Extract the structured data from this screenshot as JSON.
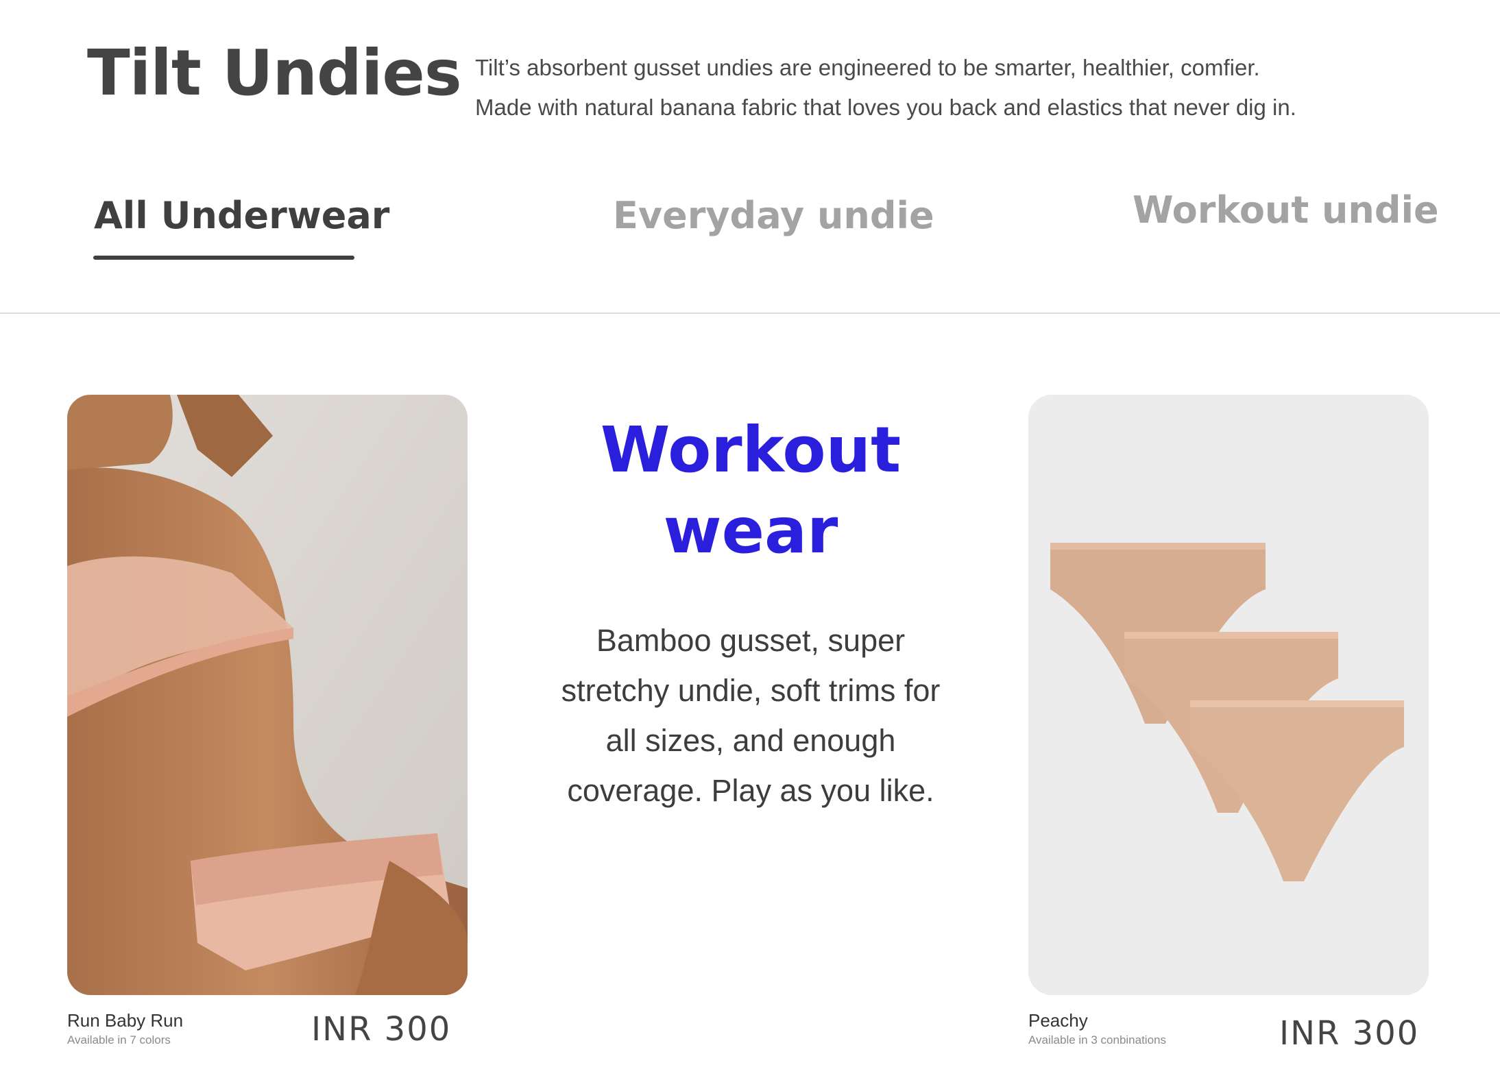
{
  "header": {
    "title": "Tilt Undies",
    "description_lines": [
      "Tilt’s absorbent gusset undies are engineered to be smarter, healthier, comfier.",
      "Made with natural banana fabric that loves you back and elastics that never dig in."
    ]
  },
  "tabs": [
    {
      "label": "All Underwear",
      "active": true
    },
    {
      "label": "Everyday undie",
      "active": false
    },
    {
      "label": "Workout undie",
      "active": false
    }
  ],
  "feature": {
    "title_lines": [
      "Workout",
      "wear"
    ],
    "description_lines": [
      "Bamboo gusset, super",
      "stretchy undie, soft trims for",
      "all sizes, and enough",
      "coverage. Play as you like."
    ],
    "accent_color": "#2a1fdc"
  },
  "products": [
    {
      "name": "Run Baby Run",
      "availability": "Available in 7 colors",
      "price": "INR 300",
      "image_icon": "model-photo"
    },
    {
      "name": "Peachy",
      "availability": "Available in 3 conbinations",
      "price": "INR 300",
      "image_icon": "briefs-photo"
    }
  ]
}
